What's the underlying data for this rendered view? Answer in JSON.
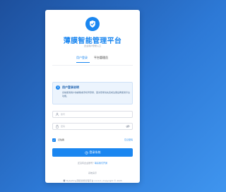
{
  "app": {
    "title": "薄膜智能管理平台",
    "subtitle": "企业用户登录入口"
  },
  "tabs": [
    {
      "label": "用户登录",
      "active": true
    },
    {
      "label": "平台管理员",
      "active": false
    }
  ],
  "notice": {
    "title": "用户登录说明",
    "text": "系统使用用户的邮箱或手机号登录，首次登录请先完成注册后再使用平台功能。"
  },
  "form": {
    "username_placeholder": "账号",
    "password_placeholder": "密码",
    "remember_label": "记住我",
    "remember_checked": true,
    "forgot_link": "忘记密码"
  },
  "login_button": {
    "label": "登录系统"
  },
  "register": {
    "prefix": "还没有企业账号？",
    "link": "联系我们开通"
  },
  "demo": {
    "text": "系统演示"
  },
  "footer": {
    "text": "ByteWing薄膜智能管理平台 v1.0.0 | Copyright © 2025"
  },
  "colors": {
    "accent": "#1a86f0",
    "background_start": "#1d4f9c",
    "background_end": "#3f95ef"
  },
  "icons": {
    "logo": "shield-check-icon",
    "notice": "info-icon",
    "username": "user-icon",
    "password": "lock-icon",
    "password_toggle": "eye-icon",
    "login": "login-icon",
    "footer": "shield-icon"
  }
}
